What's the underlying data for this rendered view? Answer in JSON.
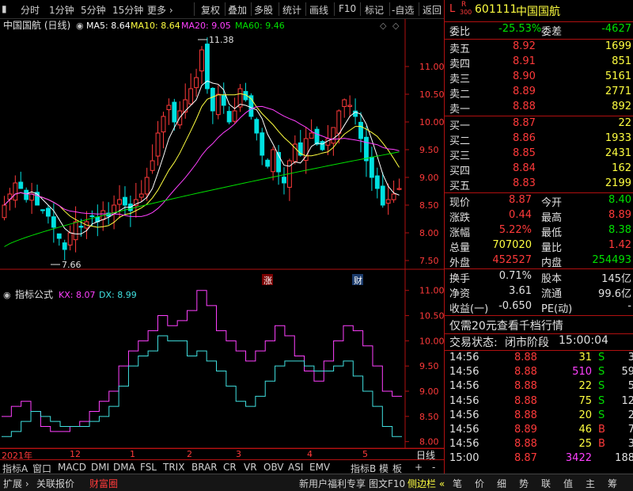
{
  "topbar": {
    "items": [
      "分时",
      "1分钟",
      "5分钟",
      "15分钟",
      "更多 ›",
      "复权",
      "叠加",
      "多股",
      "统计",
      "画线",
      "F10",
      "标记",
      "-自选",
      "返回"
    ]
  },
  "main_chart": {
    "title": "中国国航 (日线)",
    "ma5": "MA5: 8.64",
    "ma10": "MA10: 8.64",
    "ma20": "MA20: 9.05",
    "ma60": "MA60: 9.46",
    "high_label": "11.38",
    "low_label": "7.66",
    "yticks": [
      "11.00",
      "10.50",
      "10.00",
      "9.50",
      "9.00",
      "8.50",
      "8.00",
      "7.50"
    ],
    "marker_up": "涨",
    "marker_fin": "财"
  },
  "indicator": {
    "title": "指标公式",
    "kx": "KX: 8.07",
    "dx": "DX: 8.99",
    "yticks": [
      "11.00",
      "10.50",
      "10.00",
      "9.50",
      "9.00",
      "8.50",
      "8.00"
    ]
  },
  "xaxis": {
    "year": "2021年",
    "months": [
      "12",
      "1",
      "2",
      "3",
      "4",
      "5"
    ],
    "period": "日线"
  },
  "chart_data": [
    {
      "type": "candlestick",
      "title": "中国国航 (日线)",
      "ylim": [
        7.4,
        11.6
      ],
      "series_names": [
        "MA5",
        "MA10",
        "MA20",
        "MA60"
      ],
      "close": [
        8.5,
        8.7,
        8.9,
        8.8,
        8.6,
        8.7,
        8.5,
        8.4,
        8.3,
        8.1,
        7.9,
        7.7,
        8.0,
        8.2,
        8.1,
        8.2,
        8.3,
        8.2,
        8.4,
        8.3,
        8.5,
        8.6,
        8.5,
        8.4,
        8.6,
        8.7,
        9.0,
        9.3,
        9.8,
        10.1,
        10.3,
        10.0,
        10.2,
        10.4,
        10.6,
        10.8,
        11.3,
        10.6,
        10.2,
        10.5,
        10.3,
        10.0,
        10.2,
        10.6,
        10.4,
        10.1,
        9.8,
        9.4,
        9.2,
        9.5,
        9.1,
        8.9,
        9.3,
        9.6,
        9.4,
        9.7,
        9.8,
        9.6,
        9.5,
        9.7,
        9.9,
        10.2,
        10.4,
        10.3,
        10.1,
        9.7,
        9.3,
        9.0,
        8.8,
        8.5,
        8.6,
        8.7,
        8.8
      ],
      "ma60_end": 9.46
    },
    {
      "type": "line",
      "title": "指标公式",
      "ylim": [
        7.9,
        11.2
      ],
      "series": [
        {
          "name": "KX",
          "values": [
            8.5,
            8.7,
            8.8,
            8.6,
            8.3,
            8.2,
            8.2,
            8.3,
            8.4,
            8.6,
            8.8,
            9.0,
            9.5,
            9.8,
            10.0,
            10.2,
            10.5,
            10.3,
            10.4,
            10.6,
            11.0,
            10.7,
            10.2,
            10.0,
            9.8,
            9.6,
            9.8,
            10.0,
            10.3,
            10.1,
            9.7,
            9.4,
            9.2,
            9.6,
            10.0,
            10.3,
            10.2,
            9.9,
            9.5,
            9.0,
            8.9
          ]
        },
        {
          "name": "DX",
          "values": [
            8.1,
            8.2,
            8.4,
            8.6,
            8.5,
            8.4,
            8.3,
            8.3,
            8.3,
            8.4,
            8.5,
            8.7,
            9.1,
            9.5,
            9.7,
            9.8,
            10.1,
            10.0,
            10.0,
            9.7,
            9.8,
            9.6,
            9.4,
            9.1,
            8.8,
            8.7,
            8.9,
            9.2,
            9.5,
            9.6,
            9.6,
            9.5,
            9.4,
            9.4,
            9.5,
            9.6,
            9.3,
            9.0,
            8.7,
            8.3,
            8.1
          ]
        }
      ]
    }
  ],
  "quote": {
    "code_prefix": "L",
    "code_r": "R",
    "code_sub": "300",
    "code": "601111",
    "name": "中国国航",
    "webi_label": "委比",
    "webi_val": "-25.53%",
    "weicha_label": "委差",
    "weicha_val": "-4627",
    "asks": [
      {
        "label": "卖五",
        "price": "8.92",
        "vol": "1699"
      },
      {
        "label": "卖四",
        "price": "8.91",
        "vol": "851"
      },
      {
        "label": "卖三",
        "price": "8.90",
        "vol": "5161"
      },
      {
        "label": "卖二",
        "price": "8.89",
        "vol": "2771"
      },
      {
        "label": "卖一",
        "price": "8.88",
        "vol": "892"
      }
    ],
    "bids": [
      {
        "label": "买一",
        "price": "8.87",
        "vol": "22"
      },
      {
        "label": "买二",
        "price": "8.86",
        "vol": "1933"
      },
      {
        "label": "买三",
        "price": "8.85",
        "vol": "2431"
      },
      {
        "label": "买四",
        "price": "8.84",
        "vol": "162"
      },
      {
        "label": "买五",
        "price": "8.83",
        "vol": "2199"
      }
    ],
    "stats": [
      {
        "l1": "现价",
        "v1": "8.87",
        "l2": "今开",
        "v2": "8.40",
        "c1": "red",
        "c2": "green"
      },
      {
        "l1": "涨跌",
        "v1": "0.44",
        "l2": "最高",
        "v2": "8.89",
        "c1": "red",
        "c2": "red"
      },
      {
        "l1": "涨幅",
        "v1": "5.22%",
        "l2": "最低",
        "v2": "8.38",
        "c1": "red",
        "c2": "green"
      },
      {
        "l1": "总量",
        "v1": "707020",
        "l2": "量比",
        "v2": "1.42",
        "c1": "yellow",
        "c2": "red"
      },
      {
        "l1": "外盘",
        "v1": "452527",
        "l2": "内盘",
        "v2": "254493",
        "c1": "red",
        "c2": "green"
      }
    ],
    "stats2": [
      {
        "l1": "换手",
        "v1": "0.71%",
        "l2": "股本",
        "v2": "145亿"
      },
      {
        "l1": "净资",
        "v1": "3.61",
        "l2": "流通",
        "v2": "99.6亿"
      },
      {
        "l1": "收益(一)",
        "v1": "-0.650",
        "l2": "PE(动)",
        "v2": "-"
      }
    ],
    "promo": "仅需20元查看千档行情",
    "status_label": "交易状态:",
    "status_val": "闭市阶段",
    "status_time": "15:00:04",
    "ticks": [
      {
        "t": "14:56",
        "p": "8.88",
        "v": "31",
        "d": "S",
        "n": "3",
        "vc": "yellow",
        "dc": "green"
      },
      {
        "t": "14:56",
        "p": "8.88",
        "v": "510",
        "d": "S",
        "n": "59",
        "vc": "magenta",
        "dc": "green"
      },
      {
        "t": "14:56",
        "p": "8.88",
        "v": "22",
        "d": "S",
        "n": "5",
        "vc": "yellow",
        "dc": "green"
      },
      {
        "t": "14:56",
        "p": "8.88",
        "v": "75",
        "d": "S",
        "n": "12",
        "vc": "yellow",
        "dc": "green"
      },
      {
        "t": "14:56",
        "p": "8.88",
        "v": "20",
        "d": "S",
        "n": "2",
        "vc": "yellow",
        "dc": "green"
      },
      {
        "t": "14:56",
        "p": "8.89",
        "v": "46",
        "d": "B",
        "n": "7",
        "vc": "yellow",
        "dc": "red"
      },
      {
        "t": "14:56",
        "p": "8.88",
        "v": "25",
        "d": "B",
        "n": "3",
        "vc": "yellow",
        "dc": "red"
      },
      {
        "t": "15:00",
        "p": "8.87",
        "v": "3422",
        "d": "",
        "n": "188",
        "vc": "magenta",
        "dc": "red"
      }
    ]
  },
  "tabs": [
    "指标A",
    "窗口",
    "MACD",
    "DMI",
    "DMA",
    "FSL",
    "TRIX",
    "BRAR",
    "CR",
    "VR",
    "OBV",
    "ASI",
    "EMV",
    "指标B",
    "模",
    "板",
    "+",
    "-"
  ],
  "bottom_tabs": [
    "扩展 ›",
    "关联报价",
    "财富圈",
    "新用户福利专享",
    "图文F10",
    "侧边栏 «",
    "笔",
    "价",
    "细",
    "势",
    "联",
    "值",
    "主",
    "筹"
  ],
  "colors": {
    "up": "#ff3a3a",
    "down": "#00e0e0",
    "ma5": "#ffffff",
    "ma10": "#ffff40",
    "ma20": "#ff40ff",
    "ma60": "#00e000",
    "border": "#b01010"
  }
}
